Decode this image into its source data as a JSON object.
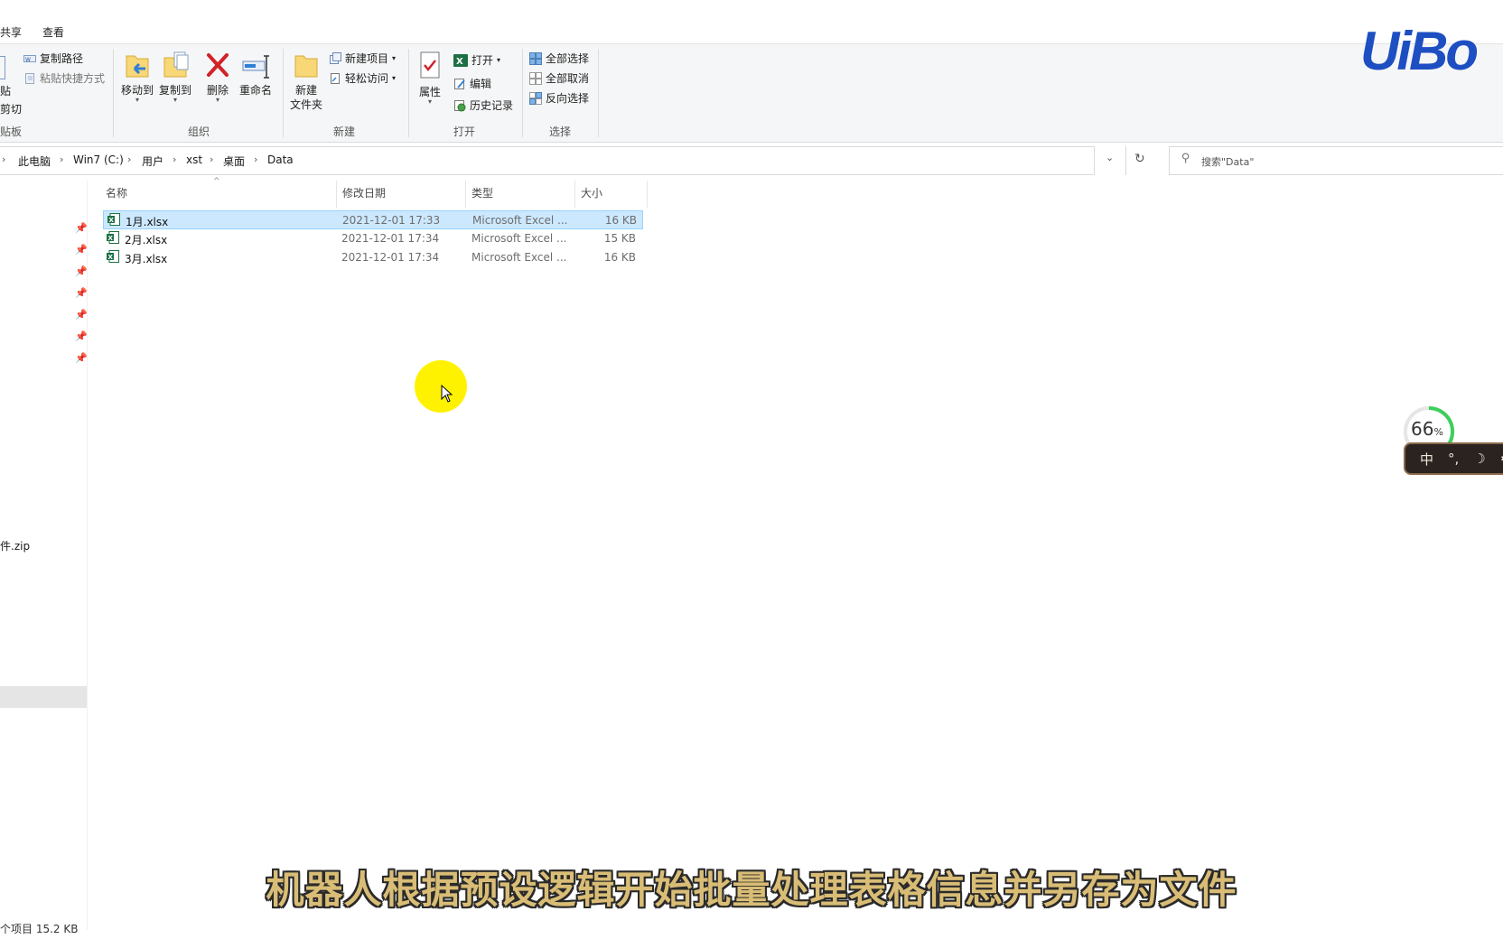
{
  "menu": {
    "tabs": [
      "共享",
      "查看"
    ]
  },
  "ribbon": {
    "clipboard": {
      "copy_path": "复制路径",
      "paste_shortcut": "粘贴快捷方式",
      "paste_label": "贴",
      "cut_label": "剪切",
      "group_label": "贴板"
    },
    "organize": {
      "move_to": "移动到",
      "copy_to": "复制到",
      "delete": "删除",
      "rename": "重命名",
      "group_label": "组织"
    },
    "new": {
      "new_folder_line1": "新建",
      "new_folder_line2": "文件夹",
      "new_item": "新建项目",
      "easy_access": "轻松访问",
      "group_label": "新建"
    },
    "open": {
      "properties": "属性",
      "open": "打开",
      "edit": "编辑",
      "history": "历史记录",
      "group_label": "打开"
    },
    "select": {
      "select_all": "全部选择",
      "select_none": "全部取消",
      "invert": "反向选择",
      "group_label": "选择"
    }
  },
  "address": {
    "crumbs": [
      "此电脑",
      "Win7 (C:)",
      "用户",
      "xst",
      "桌面",
      "Data"
    ]
  },
  "search": {
    "placeholder": "搜索\"Data\""
  },
  "columns": {
    "name": "名称",
    "date": "修改日期",
    "type": "类型",
    "size": "大小"
  },
  "files": [
    {
      "name": "1月.xlsx",
      "date": "2021-12-01 17:33",
      "type": "Microsoft Excel ...",
      "size": "16 KB",
      "selected": true
    },
    {
      "name": "2月.xlsx",
      "date": "2021-12-01 17:34",
      "type": "Microsoft Excel ...",
      "size": "15 KB",
      "selected": false
    },
    {
      "name": "3月.xlsx",
      "date": "2021-12-01 17:34",
      "type": "Microsoft Excel ...",
      "size": "16 KB",
      "selected": false
    }
  ],
  "nav": {
    "zip_item": "件.zip"
  },
  "status": {
    "text": "个项目  15.2 KB"
  },
  "overlay": {
    "caption": "机器人根据预设逻辑开始批量处理表格信息并另存为文件",
    "logo": "UiBo",
    "gauge_value": "66",
    "gauge_unit": "%",
    "ime": [
      "中",
      "°,",
      "☽",
      "⚙"
    ]
  },
  "colors": {
    "accent_logo": "#1e4fc2",
    "selection": "#cce8ff",
    "excel_green": "#1d7044",
    "delete_red": "#d1232a"
  }
}
